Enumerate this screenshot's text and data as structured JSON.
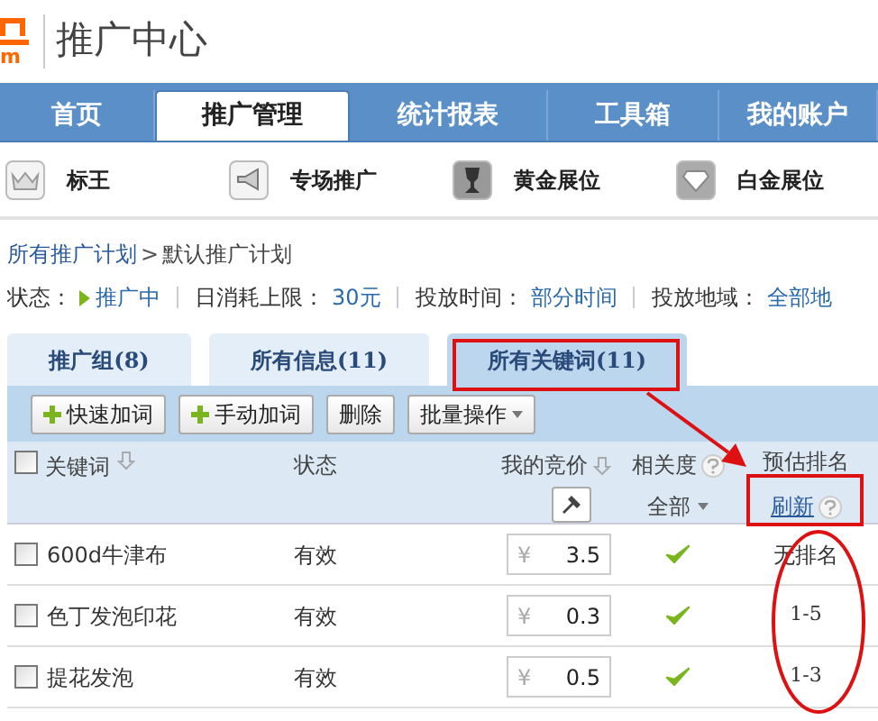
{
  "header": {
    "logo_text": "m",
    "title": "推广中心"
  },
  "nav": [
    {
      "label": "首页",
      "selected": false
    },
    {
      "label": "推广管理",
      "selected": true
    },
    {
      "label": "统计报表",
      "selected": false
    },
    {
      "label": "工具箱",
      "selected": false
    },
    {
      "label": "我的账户",
      "selected": false
    }
  ],
  "subnav": [
    {
      "label": "标王"
    },
    {
      "label": "专场推广"
    },
    {
      "label": "黄金展位"
    },
    {
      "label": "白金展位"
    }
  ],
  "breadcrumb": {
    "parent": "所有推广计划",
    "separator": ">",
    "current": "默认推广计划"
  },
  "status_line": [
    {
      "label": "状态：",
      "value": "推广中",
      "play": true
    },
    {
      "label": "日消耗上限：",
      "value": "30元",
      "play": false
    },
    {
      "label": "投放时间：",
      "value": "部分时间",
      "play": false
    },
    {
      "label": "投放地域：",
      "value": "全部地",
      "play": false
    }
  ],
  "tabs": [
    {
      "label": "推广组",
      "count": "(8)",
      "selected": false
    },
    {
      "label": "所有信息",
      "count": "(11)",
      "selected": false
    },
    {
      "label": "所有关键词",
      "count": "(11)",
      "selected": true
    }
  ],
  "toolbar": [
    {
      "label": "快速加词",
      "kind": "add"
    },
    {
      "label": "手动加词",
      "kind": "add"
    },
    {
      "label": "删除",
      "kind": "plain"
    },
    {
      "label": "批量操作",
      "kind": "dropdown"
    }
  ],
  "table": {
    "columns": {
      "keyword": "关键词",
      "status": "状态",
      "bid": "我的竞价",
      "relevance": "相关度",
      "relevance_filter": "全部",
      "rank": "预估排名",
      "refresh": "刷新"
    },
    "select_all_checked": false,
    "rows": [
      {
        "keyword": "600d牛津布",
        "status": "有效",
        "currency": "¥",
        "bid": "3.5",
        "relevant": true,
        "rank": "无排名",
        "checked": false
      },
      {
        "keyword": "色丁发泡印花",
        "status": "有效",
        "currency": "¥",
        "bid": "0.3",
        "relevant": true,
        "rank": "1-5",
        "checked": false
      },
      {
        "keyword": "提花发泡",
        "status": "有效",
        "currency": "¥",
        "bid": "0.5",
        "relevant": true,
        "rank": "1-3",
        "checked": false
      }
    ]
  }
}
